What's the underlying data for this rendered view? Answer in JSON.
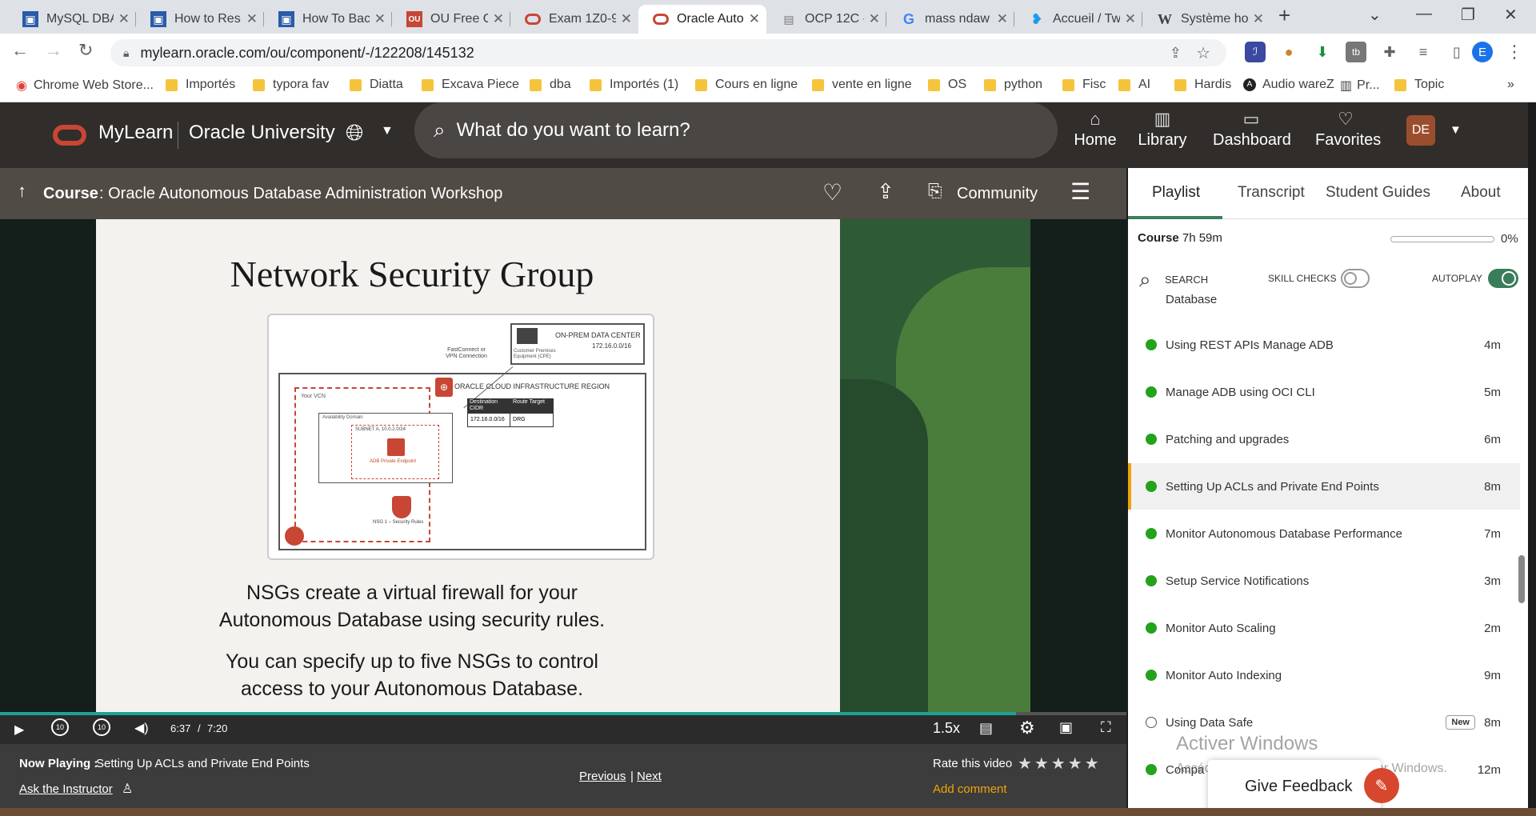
{
  "browser": {
    "tabs": [
      {
        "title": "MySQL DBA",
        "icon": "image-favicon"
      },
      {
        "title": "How to Res",
        "icon": "image-favicon"
      },
      {
        "title": "How To Bac",
        "icon": "image-favicon"
      },
      {
        "title": "OU Free OC",
        "icon": "ou-favicon"
      },
      {
        "title": "Exam 1Z0-9",
        "icon": "oracle-favicon"
      },
      {
        "title": "Oracle Auto",
        "icon": "oracle-favicon"
      },
      {
        "title": "OCP 12C - I",
        "icon": "doc-favicon"
      },
      {
        "title": "mass ndaw",
        "icon": "google-favicon"
      },
      {
        "title": "Accueil / Tw",
        "icon": "twitter-favicon"
      },
      {
        "title": "Système ho",
        "icon": "wikipedia-favicon"
      }
    ],
    "url": "mylearn.oracle.com/ou/component/-/122208/145132",
    "profile_initial": "E",
    "bookmarks": [
      "Chrome Web Store...",
      "Importés",
      "typora fav",
      "Diatta",
      "Excava Piece",
      "dba",
      "Importés (1)",
      "Cours en ligne",
      "vente en ligne",
      "OS",
      "python",
      "Fisc",
      "AI",
      "Hardis",
      "Audio wareZ",
      "Pr...",
      "Topic"
    ]
  },
  "header": {
    "brand": "MyLearn",
    "brand2": "Oracle University",
    "search_placeholder": "What do you want to learn?",
    "nav": [
      "Home",
      "Library",
      "Dashboard",
      "Favorites"
    ],
    "avatar": "DE"
  },
  "course": {
    "label": "Course",
    "title": ": Oracle Autonomous Database Administration Workshop",
    "community": "Community"
  },
  "panel": {
    "tabs": [
      "Playlist",
      "Transcript",
      "Student Guides",
      "About"
    ],
    "course_label": "Course",
    "duration": "7h 59m",
    "progress": "0%",
    "search": "SEARCH",
    "skill_checks": "SKILL CHECKS",
    "autoplay": "AUTOPLAY",
    "partial_item": "Database",
    "items": [
      {
        "title": "Using REST APIs Manage ADB",
        "duration": "4m",
        "done": true
      },
      {
        "title": "Manage ADB using OCI CLI",
        "duration": "5m",
        "done": true
      },
      {
        "title": "Patching and upgrades",
        "duration": "6m",
        "done": true
      },
      {
        "title": "Setting Up ACLs and Private End Points",
        "duration": "8m",
        "done": true,
        "active": true
      },
      {
        "title": "Monitor Autonomous Database Performance",
        "duration": "7m",
        "done": true
      },
      {
        "title": "Setup Service Notifications",
        "duration": "3m",
        "done": true
      },
      {
        "title": "Monitor Auto Scaling",
        "duration": "2m",
        "done": true
      },
      {
        "title": "Monitor Auto Indexing",
        "duration": "9m",
        "done": true
      },
      {
        "title": "Using Data Safe",
        "duration": "8m",
        "done": false,
        "badge": "New"
      },
      {
        "title": "Compa",
        "duration": "12m",
        "done": true
      }
    ],
    "watermark1": "Activer Windows",
    "watermark2": "Accédez aux paramètres pour activer Windows.",
    "feedback": "Give Feedback"
  },
  "slide": {
    "title": "Network Security Group",
    "onprem": "ON-PREM DATA CENTER",
    "cpe": "Customer Premises Equipment (CPE)",
    "cidr": "172.16.0.0/16",
    "fastconnect": "FastConnect or VPN Connection",
    "region": "ORACLE CLOUD INFRASTRUCTURE REGION",
    "vcn": "Your VCN",
    "ad": "Availability Domain",
    "subnet": "SUBNET A, 10.0.2.0/24",
    "endpoint": "ADB Private Endpoint",
    "nsg": "NSG 1 – Security Rules",
    "rt_dest": "Destination CIDR",
    "rt_target": "Route Target",
    "rt_cidr": "172.16.0.0/16",
    "rt_drg": "DRG",
    "text1": "NSGs create a virtual firewall for your Autonomous Database using security rules.",
    "text2": "You can specify up to five NSGs to control access to your Autonomous Database."
  },
  "player": {
    "time": "6:37",
    "total": "7:20",
    "speed": "1.5x",
    "progress": 0.902,
    "rewind_label": "10",
    "forward_label": "10"
  },
  "info": {
    "now_playing": "Now Playing :",
    "now_title": "Setting Up ACLs and Private End Points",
    "ask": "Ask the Instructor",
    "previous": "Previous",
    "next": "Next",
    "rate": "Rate this video",
    "add_comment": "Add comment"
  },
  "colors": {
    "accent": "#c74634",
    "complete": "#24a21c",
    "active_bar": "#f0a30a",
    "progress_bar": "#1fa296"
  }
}
